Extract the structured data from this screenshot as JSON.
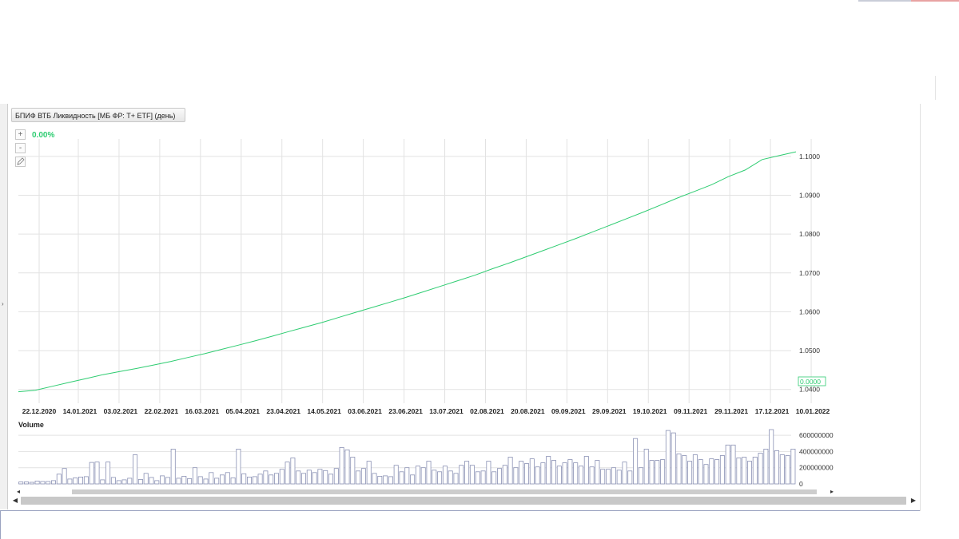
{
  "chart_title": "БПИФ ВТБ Ликвидность [МБ ФР: T+ ETF] (день)",
  "tools": {
    "zoom_in": "+",
    "zoom_out": "-"
  },
  "change_percent": "0.00%",
  "volume_label": "Volume",
  "colors": {
    "price_line": "#2ecc71",
    "volume_bar": "#8a91b4",
    "grid": "#e2e2e2",
    "accent": "#2ecc71"
  },
  "icons": {
    "edit": "pencil-icon",
    "scroll_left": "triangle-left-icon",
    "scroll_right": "triangle-right-icon"
  },
  "chart_data": [
    {
      "type": "line",
      "series": [
        {
          "values": [
            1.0394,
            1.0398,
            1.0408,
            1.0418,
            1.0428,
            1.0438,
            1.0446,
            1.0454,
            1.0463,
            1.0472,
            1.0482,
            1.0492,
            1.0503,
            1.0514,
            1.0525,
            1.0537,
            1.0549,
            1.0561,
            1.0573,
            1.0586,
            1.0599,
            1.0612,
            1.0625,
            1.0638,
            1.0652,
            1.0666,
            1.068,
            1.0694,
            1.071,
            1.0725,
            1.0741,
            1.0757,
            1.0773,
            1.0789,
            1.0806,
            1.0823,
            1.084,
            1.0857,
            1.0875,
            1.0893,
            1.091,
            1.0927,
            1.0948,
            1.0965,
            1.0992,
            1.1002,
            1.1012
          ]
        }
      ],
      "x_tick_labels": [
        "22.12.2020",
        "14.01.2021",
        "03.02.2021",
        "22.02.2021",
        "16.03.2021",
        "05.04.2021",
        "23.04.2021",
        "14.05.2021",
        "03.06.2021",
        "23.06.2021",
        "13.07.2021",
        "02.08.2021",
        "20.08.2021",
        "09.09.2021",
        "29.09.2021",
        "19.10.2021",
        "09.11.2021",
        "29.11.2021",
        "17.12.2021",
        "10.01.2022"
      ],
      "y_tick_labels": [
        "1.1000",
        "1.0900",
        "1.0800",
        "1.0700",
        "1.0600",
        "1.0500",
        "1.0400"
      ],
      "ylim": [
        1.0385,
        1.1045
      ],
      "current_value_label": "0.0000",
      "grid": true
    },
    {
      "type": "bar",
      "title": "Volume",
      "values": [
        25000000,
        25000000,
        20000000,
        35000000,
        30000000,
        30000000,
        40000000,
        120000000,
        190000000,
        60000000,
        75000000,
        85000000,
        90000000,
        265000000,
        270000000,
        50000000,
        270000000,
        80000000,
        40000000,
        50000000,
        70000000,
        360000000,
        55000000,
        130000000,
        80000000,
        40000000,
        100000000,
        80000000,
        430000000,
        70000000,
        95000000,
        65000000,
        200000000,
        90000000,
        60000000,
        140000000,
        70000000,
        110000000,
        140000000,
        75000000,
        430000000,
        125000000,
        85000000,
        90000000,
        120000000,
        160000000,
        110000000,
        130000000,
        180000000,
        270000000,
        320000000,
        160000000,
        130000000,
        170000000,
        140000000,
        180000000,
        165000000,
        120000000,
        190000000,
        450000000,
        420000000,
        330000000,
        160000000,
        190000000,
        280000000,
        130000000,
        95000000,
        100000000,
        90000000,
        230000000,
        150000000,
        200000000,
        110000000,
        220000000,
        200000000,
        280000000,
        170000000,
        150000000,
        220000000,
        160000000,
        130000000,
        230000000,
        280000000,
        230000000,
        150000000,
        160000000,
        280000000,
        150000000,
        190000000,
        230000000,
        330000000,
        200000000,
        280000000,
        250000000,
        310000000,
        210000000,
        260000000,
        340000000,
        290000000,
        220000000,
        260000000,
        300000000,
        260000000,
        220000000,
        340000000,
        210000000,
        290000000,
        180000000,
        180000000,
        200000000,
        170000000,
        270000000,
        160000000,
        560000000,
        200000000,
        430000000,
        290000000,
        290000000,
        300000000,
        660000000,
        630000000,
        370000000,
        350000000,
        280000000,
        360000000,
        300000000,
        240000000,
        310000000,
        300000000,
        350000000,
        480000000,
        480000000,
        320000000,
        330000000,
        280000000,
        330000000,
        380000000,
        430000000,
        670000000,
        410000000,
        360000000,
        350000000,
        430000000
      ],
      "y_tick_labels": [
        "600000000",
        "400000000",
        "200000000",
        "0"
      ],
      "ylim": [
        0,
        700000000
      ]
    }
  ]
}
